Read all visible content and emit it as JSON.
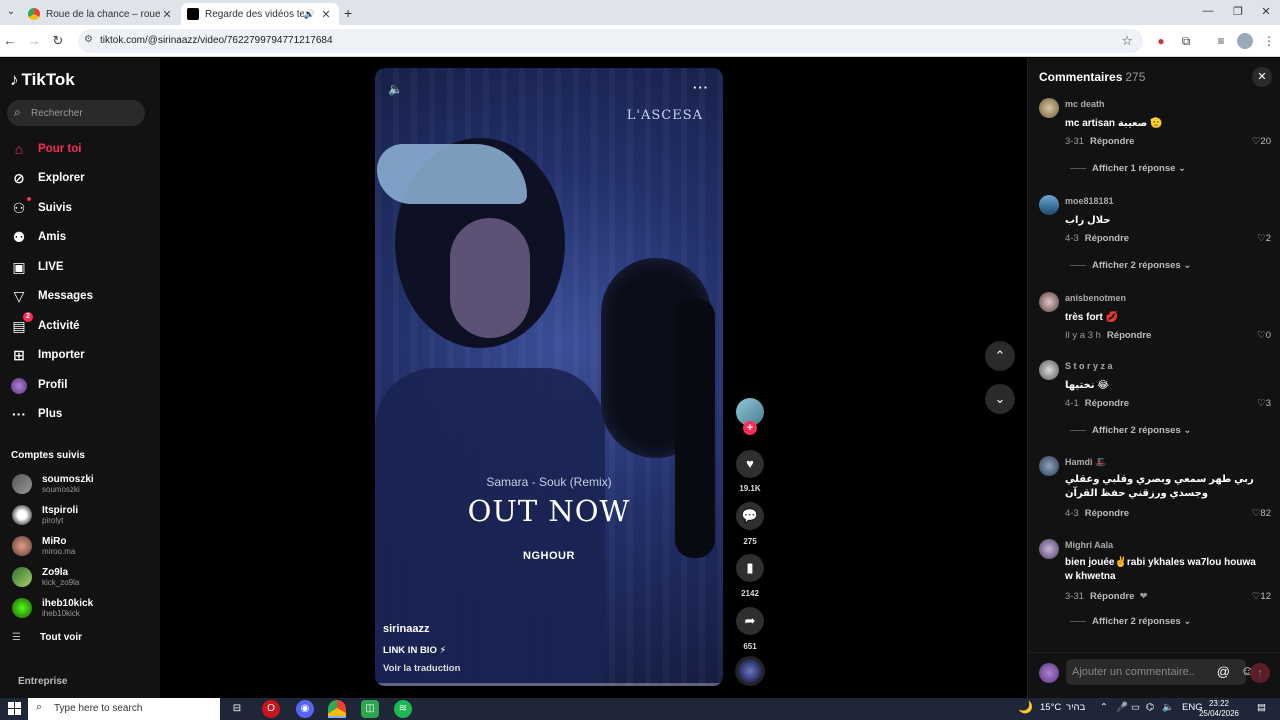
{
  "browser": {
    "tabs": [
      {
        "title": "Roue de la chance – roue aléat",
        "active": false
      },
      {
        "title": "Regarde des vidéos tendan",
        "active": true
      }
    ],
    "url": "tiktok.com/@sirinaazz/video/7622799794771217684"
  },
  "sidebar": {
    "logo": "TikTok",
    "search_placeholder": "Rechercher",
    "nav": [
      {
        "label": "Pour toi",
        "icon": "home-icon"
      },
      {
        "label": "Explorer",
        "icon": "compass-icon"
      },
      {
        "label": "Suivis",
        "icon": "following-icon"
      },
      {
        "label": "Amis",
        "icon": "friends-icon"
      },
      {
        "label": "LIVE",
        "icon": "live-icon"
      },
      {
        "label": "Messages",
        "icon": "messages-icon"
      },
      {
        "label": "Activité",
        "icon": "activity-icon",
        "badge": "2"
      },
      {
        "label": "Importer",
        "icon": "upload-icon"
      },
      {
        "label": "Profil",
        "icon": "profile-icon"
      },
      {
        "label": "Plus",
        "icon": "more-icon"
      }
    ],
    "followed_title": "Comptes suivis",
    "followed": [
      {
        "name": "soumoszki",
        "handle": "soumoszki"
      },
      {
        "name": "Itspiroli",
        "handle": "pirolyt"
      },
      {
        "name": "MiRo",
        "handle": "miroo.ma"
      },
      {
        "name": "Zo9la",
        "handle": "kick_zo9la"
      },
      {
        "name": "iheb10kick",
        "handle": "iheb10kick"
      }
    ],
    "see_all": "Tout voir",
    "company": "Entreprise"
  },
  "video": {
    "brand": "L'ASCESA",
    "song": "Samara - Souk (Remix)",
    "headline": "OUT NOW",
    "artist": "NGHOUR",
    "author": "sirinaazz",
    "description": "LINK IN BIO ⚡",
    "translate": "Voir la traduction"
  },
  "actions": {
    "likes": "19.1K",
    "comments": "275",
    "saves": "2142",
    "shares": "651"
  },
  "comments_panel": {
    "title": "Commentaires",
    "count": "275",
    "reply_label": "Répondre",
    "input_placeholder": "Ajouter un commentaire...",
    "items": [
      {
        "user": "mc death",
        "text": "mc artisan صعيبة 🫡",
        "date": "3-31",
        "likes": "20",
        "replies": "Afficher 1 réponse"
      },
      {
        "user": "moe818181",
        "text": "حلال راب",
        "date": "4-3",
        "likes": "2",
        "replies": "Afficher 2 réponses"
      },
      {
        "user": "anisbenotmen",
        "text": "très fort 💋",
        "date": "Il y a 3 h",
        "likes": "0",
        "replies": ""
      },
      {
        "user": "S t o r y z a",
        "text": "نختيها 😂",
        "date": "4-1",
        "likes": "3",
        "replies": "Afficher 2 réponses"
      },
      {
        "user": "Hamdi 🎩",
        "text": "ربي طهر سمعي وبصري وقلبي وعقلي وجسدي ورزقني حفظ القرآن",
        "date": "4-3",
        "likes": "82",
        "replies": ""
      },
      {
        "user": "Mighri Aala",
        "text": "bien jouée✌️rabi ykhales wa7lou houwa w khwetna",
        "date": "3-31",
        "likes": "12",
        "replies": "Afficher 2 réponses"
      }
    ]
  },
  "taskbar": {
    "search_placeholder": "Type here to search",
    "temperature": "15°C",
    "weather_label": "בהיר",
    "lang": "ENG",
    "time": "23:22",
    "date": "25/04/2026"
  },
  "colors": {
    "accent": "#fe2c55",
    "background": "#000000",
    "panel": "#121212"
  }
}
